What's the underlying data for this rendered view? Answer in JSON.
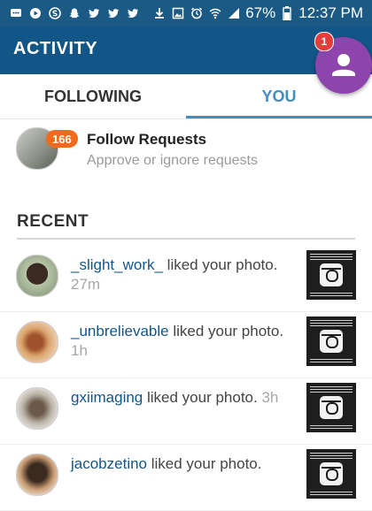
{
  "status_bar": {
    "left_icons": [
      "message-icon",
      "play-icon",
      "s-app-icon",
      "snapchat-icon",
      "twitter-icon",
      "twitter-icon",
      "twitter-icon"
    ],
    "right_icons": [
      "download-icon",
      "image-icon",
      "alarm-icon",
      "wifi-icon",
      "signal-icon"
    ],
    "battery": "67%",
    "time": "12:37 PM"
  },
  "header": {
    "title": "ACTIVITY"
  },
  "fab": {
    "badge": "1",
    "icon": "person-icon",
    "color": "#8e44ad"
  },
  "tabs": [
    {
      "label": "FOLLOWING",
      "active": false
    },
    {
      "label": "YOU",
      "active": true
    }
  ],
  "follow_requests": {
    "badge": "166",
    "title": "Follow Requests",
    "subtitle": "Approve or ignore requests"
  },
  "recent": {
    "header": "RECENT",
    "items": [
      {
        "user": "_slight_work_",
        "action": " liked your photo. ",
        "time": "27m"
      },
      {
        "user": "_unbrelievable",
        "action": " liked your photo. ",
        "time": "1h"
      },
      {
        "user": "gxiimaging",
        "action": " liked your photo. ",
        "time": "3h"
      },
      {
        "user": "jacobzetino",
        "action": " liked your photo. ",
        "time": ""
      }
    ]
  },
  "colors": {
    "app_bar": "#125688",
    "status_bar": "#1c5a86",
    "accent": "#3f8ec4",
    "badge_orange": "#f06b1c",
    "fab_purple": "#8e44ad"
  }
}
